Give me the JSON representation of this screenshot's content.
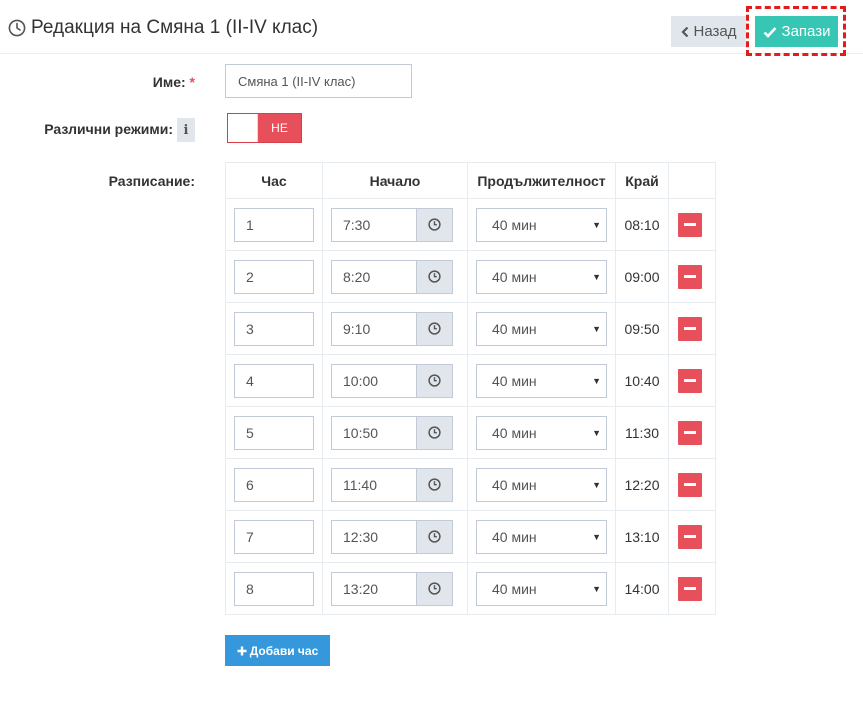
{
  "header": {
    "title": "Редакция на Смяна 1 (II-IV клас)",
    "back_label": "Назад",
    "save_label": "Запази"
  },
  "form": {
    "name_label": "Име:",
    "required_mark": "*",
    "name_value": "Смяна 1 (II-IV клас)",
    "modes_label": "Различни режими:",
    "info_glyph": "i",
    "modes_toggle_text": "НЕ",
    "schedule_label": "Разписание:"
  },
  "schedule": {
    "headers": {
      "hour": "Час",
      "start": "Начало",
      "duration": "Продължителност",
      "end": "Край"
    },
    "rows": [
      {
        "hour": "1",
        "start": "7:30",
        "duration": "40 мин",
        "end": "08:10"
      },
      {
        "hour": "2",
        "start": "8:20",
        "duration": "40 мин",
        "end": "09:00"
      },
      {
        "hour": "3",
        "start": "9:10",
        "duration": "40 мин",
        "end": "09:50"
      },
      {
        "hour": "4",
        "start": "10:00",
        "duration": "40 мин",
        "end": "10:40"
      },
      {
        "hour": "5",
        "start": "10:50",
        "duration": "40 мин",
        "end": "11:30"
      },
      {
        "hour": "6",
        "start": "11:40",
        "duration": "40 мин",
        "end": "12:20"
      },
      {
        "hour": "7",
        "start": "12:30",
        "duration": "40 мин",
        "end": "13:10"
      },
      {
        "hour": "8",
        "start": "13:20",
        "duration": "40 мин",
        "end": "14:00"
      }
    ],
    "add_label": "Добави час"
  },
  "icons": {
    "title": "clock-icon",
    "back": "chevron-left-icon",
    "save": "check-icon",
    "time": "clock-icon",
    "remove": "minus-icon",
    "add": "plus-icon",
    "info": "info-icon"
  },
  "colors": {
    "save": "#36c6b3",
    "back": "#e1e5ec",
    "toggle_off": "#e7505a",
    "remove": "#e7505a",
    "add": "#3598dc",
    "highlight": "#e31b1b"
  }
}
